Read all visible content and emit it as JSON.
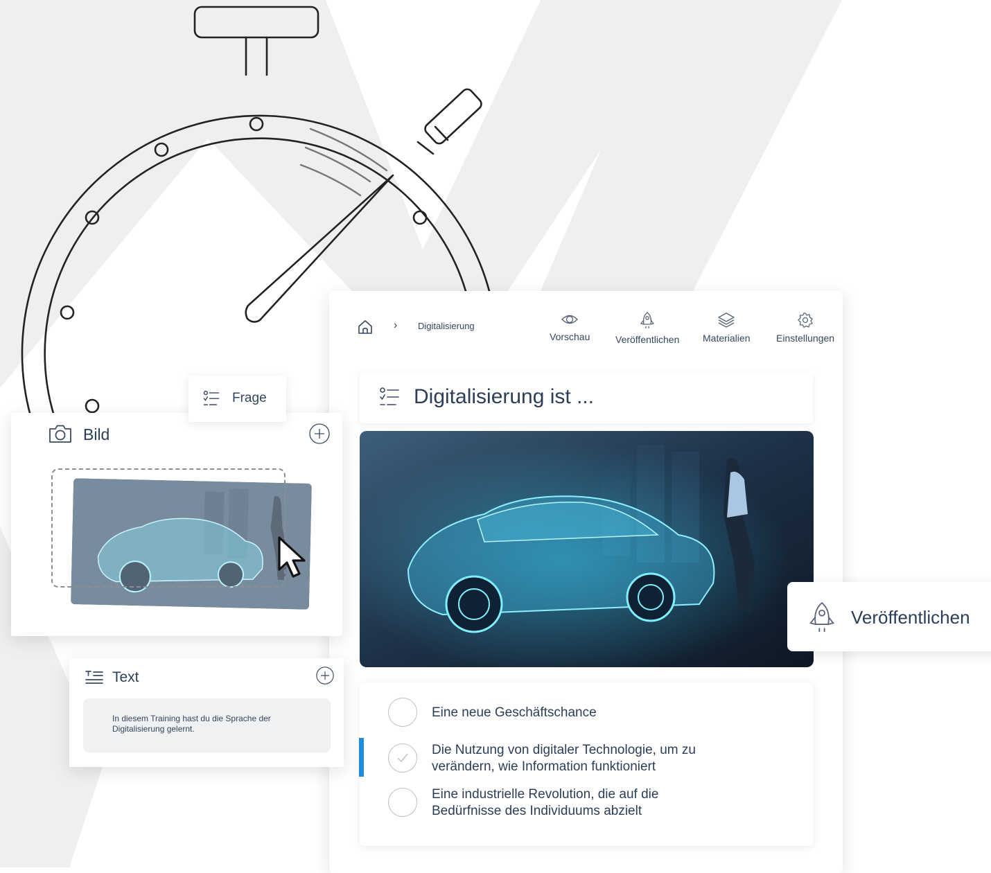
{
  "breadcrumb": {
    "current": "Digitalisierung",
    "separator": "›"
  },
  "nav": {
    "preview": "Vorschau",
    "publish": "Veröffentlichen",
    "materials": "Materialien",
    "settings": "Einstellungen"
  },
  "question": {
    "title": "Digitalisierung ist ..."
  },
  "answers": [
    {
      "label": "Eine neue Geschäftschance",
      "selected": false
    },
    {
      "label": "Die Nutzung von digitaler Technologie, um zu verändern, wie Information funktioniert",
      "selected": true
    },
    {
      "label": "Eine industrielle Revolution, die auf die Bedürfnisse des Individuums abzielt",
      "selected": false
    }
  ],
  "blocks": {
    "frage": "Frage",
    "bild": "Bild",
    "text": "Text",
    "text_body": "In diesem Training hast du die Sprache der Digitalisierung gelernt."
  },
  "publish_float": "Veröffentlichen",
  "colors": {
    "accent": "#1e8de0",
    "text": "#2c3e57"
  },
  "icons": [
    "home-icon",
    "eye-icon",
    "rocket-icon",
    "layers-icon",
    "gear-icon",
    "question-list-icon",
    "camera-icon",
    "plus-icon",
    "text-icon",
    "check-icon",
    "cursor-icon",
    "stopwatch-illustration"
  ]
}
